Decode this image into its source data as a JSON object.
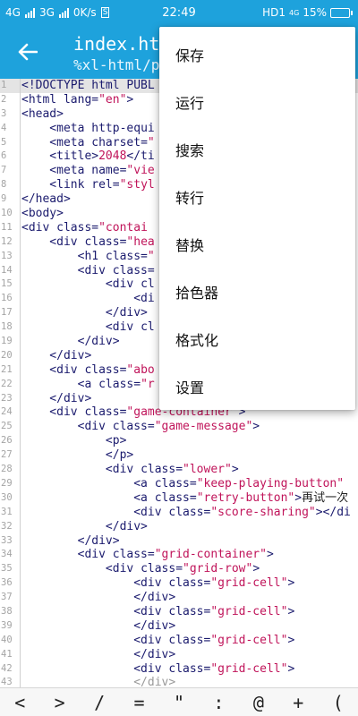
{
  "status_bar": {
    "network_1": "4G",
    "network_2": "3G",
    "speed": "0K/s",
    "s_badge": "S",
    "time": "22:49",
    "carrier": "HD1",
    "network_3": "4G",
    "battery": "15%",
    "battery_level": 0.15
  },
  "toolbar": {
    "title": "index.html",
    "path": "%xl-html/pr"
  },
  "editor": {
    "current_line": 1,
    "lines": [
      {
        "n": "1",
        "tokens": [
          {
            "t": "<!DOCTYPE html PUBL",
            "c": "c-tag"
          }
        ]
      },
      {
        "n": "2",
        "tokens": [
          {
            "t": "<html ",
            "c": "c-tag"
          },
          {
            "t": "lang=",
            "c": "c-attr"
          },
          {
            "t": "\"en\"",
            "c": "c-str"
          },
          {
            "t": ">",
            "c": "c-tag"
          }
        ]
      },
      {
        "n": "3",
        "tokens": [
          {
            "t": "<head>",
            "c": "c-tag"
          }
        ]
      },
      {
        "n": "4",
        "tokens": [
          {
            "t": "    <meta ",
            "c": "c-tag"
          },
          {
            "t": "http-equi",
            "c": "c-attr"
          }
        ]
      },
      {
        "n": "5",
        "tokens": [
          {
            "t": "    <meta ",
            "c": "c-tag"
          },
          {
            "t": "charset=",
            "c": "c-attr"
          },
          {
            "t": "\"",
            "c": "c-str"
          }
        ]
      },
      {
        "n": "6",
        "tokens": [
          {
            "t": "    <title>",
            "c": "c-tag"
          },
          {
            "t": "2048",
            "c": "c-str"
          },
          {
            "t": "</ti",
            "c": "c-tag"
          }
        ]
      },
      {
        "n": "7",
        "tokens": [
          {
            "t": "    <meta ",
            "c": "c-tag"
          },
          {
            "t": "name=",
            "c": "c-attr"
          },
          {
            "t": "\"vie",
            "c": "c-str"
          }
        ]
      },
      {
        "n": "8",
        "tokens": [
          {
            "t": "    <link ",
            "c": "c-tag"
          },
          {
            "t": "rel=",
            "c": "c-attr"
          },
          {
            "t": "\"styl",
            "c": "c-str"
          }
        ]
      },
      {
        "n": "9",
        "tokens": [
          {
            "t": "</head>",
            "c": "c-tag"
          }
        ]
      },
      {
        "n": "10",
        "tokens": [
          {
            "t": "<body>",
            "c": "c-tag"
          }
        ]
      },
      {
        "n": "11",
        "tokens": [
          {
            "t": "<div ",
            "c": "c-tag"
          },
          {
            "t": "class=",
            "c": "c-attr"
          },
          {
            "t": "\"contai",
            "c": "c-str"
          }
        ]
      },
      {
        "n": "12",
        "tokens": [
          {
            "t": "    <div ",
            "c": "c-tag"
          },
          {
            "t": "class=",
            "c": "c-attr"
          },
          {
            "t": "\"hea",
            "c": "c-str"
          }
        ]
      },
      {
        "n": "13",
        "tokens": [
          {
            "t": "        <h1 ",
            "c": "c-tag"
          },
          {
            "t": "class=",
            "c": "c-attr"
          },
          {
            "t": "\"",
            "c": "c-str"
          }
        ]
      },
      {
        "n": "14",
        "tokens": [
          {
            "t": "        <div ",
            "c": "c-tag"
          },
          {
            "t": "class=",
            "c": "c-attr"
          }
        ]
      },
      {
        "n": "15",
        "tokens": [
          {
            "t": "            <div ",
            "c": "c-tag"
          },
          {
            "t": "cl",
            "c": "c-attr"
          }
        ]
      },
      {
        "n": "16",
        "tokens": [
          {
            "t": "                <di",
            "c": "c-tag"
          }
        ]
      },
      {
        "n": "17",
        "tokens": [
          {
            "t": "            </div>",
            "c": "c-tag"
          }
        ]
      },
      {
        "n": "18",
        "tokens": [
          {
            "t": "            <div ",
            "c": "c-tag"
          },
          {
            "t": "cl",
            "c": "c-attr"
          }
        ]
      },
      {
        "n": "19",
        "tokens": [
          {
            "t": "        </div>",
            "c": "c-tag"
          }
        ]
      },
      {
        "n": "20",
        "tokens": [
          {
            "t": "    </div>",
            "c": "c-tag"
          }
        ]
      },
      {
        "n": "21",
        "tokens": [
          {
            "t": "    <div ",
            "c": "c-tag"
          },
          {
            "t": "class=",
            "c": "c-attr"
          },
          {
            "t": "\"abo",
            "c": "c-str"
          }
        ]
      },
      {
        "n": "22",
        "tokens": [
          {
            "t": "        <a ",
            "c": "c-tag"
          },
          {
            "t": "class=",
            "c": "c-attr"
          },
          {
            "t": "\"r",
            "c": "c-str"
          }
        ]
      },
      {
        "n": "23",
        "tokens": [
          {
            "t": "    </div>",
            "c": "c-tag"
          }
        ]
      },
      {
        "n": "24",
        "tokens": [
          {
            "t": "    <div ",
            "c": "c-tag"
          },
          {
            "t": "class=",
            "c": "c-attr"
          },
          {
            "t": "\"game-container\"",
            "c": "c-str"
          },
          {
            "t": ">",
            "c": "c-tag"
          }
        ]
      },
      {
        "n": "25",
        "tokens": [
          {
            "t": "        <div ",
            "c": "c-tag"
          },
          {
            "t": "class=",
            "c": "c-attr"
          },
          {
            "t": "\"game-message\"",
            "c": "c-str"
          },
          {
            "t": ">",
            "c": "c-tag"
          }
        ]
      },
      {
        "n": "26",
        "tokens": [
          {
            "t": "            <p>",
            "c": "c-tag"
          }
        ]
      },
      {
        "n": "27",
        "tokens": [
          {
            "t": "            </p>",
            "c": "c-tag"
          }
        ]
      },
      {
        "n": "28",
        "tokens": [
          {
            "t": "            <div ",
            "c": "c-tag"
          },
          {
            "t": "class=",
            "c": "c-attr"
          },
          {
            "t": "\"lower\"",
            "c": "c-str"
          },
          {
            "t": ">",
            "c": "c-tag"
          }
        ]
      },
      {
        "n": "29",
        "tokens": [
          {
            "t": "                <a ",
            "c": "c-tag"
          },
          {
            "t": "class=",
            "c": "c-attr"
          },
          {
            "t": "\"keep-playing-button\"",
            "c": "c-str"
          }
        ]
      },
      {
        "n": "30",
        "tokens": [
          {
            "t": "                <a ",
            "c": "c-tag"
          },
          {
            "t": "class=",
            "c": "c-attr"
          },
          {
            "t": "\"retry-button\"",
            "c": "c-str"
          },
          {
            "t": ">",
            "c": "c-tag"
          },
          {
            "t": "再试一次",
            "c": "c-txt"
          }
        ]
      },
      {
        "n": "31",
        "tokens": [
          {
            "t": "                <div ",
            "c": "c-tag"
          },
          {
            "t": "class=",
            "c": "c-attr"
          },
          {
            "t": "\"score-sharing\"",
            "c": "c-str"
          },
          {
            "t": "></di",
            "c": "c-tag"
          }
        ]
      },
      {
        "n": "32",
        "tokens": [
          {
            "t": "            </div>",
            "c": "c-tag"
          }
        ]
      },
      {
        "n": "33",
        "tokens": [
          {
            "t": "        </div>",
            "c": "c-tag"
          }
        ]
      },
      {
        "n": "34",
        "tokens": [
          {
            "t": "        <div ",
            "c": "c-tag"
          },
          {
            "t": "class=",
            "c": "c-attr"
          },
          {
            "t": "\"grid-container\"",
            "c": "c-str"
          },
          {
            "t": ">",
            "c": "c-tag"
          }
        ]
      },
      {
        "n": "35",
        "tokens": [
          {
            "t": "            <div ",
            "c": "c-tag"
          },
          {
            "t": "class=",
            "c": "c-attr"
          },
          {
            "t": "\"grid-row\"",
            "c": "c-str"
          },
          {
            "t": ">",
            "c": "c-tag"
          }
        ]
      },
      {
        "n": "36",
        "tokens": [
          {
            "t": "                <div ",
            "c": "c-tag"
          },
          {
            "t": "class=",
            "c": "c-attr"
          },
          {
            "t": "\"grid-cell\"",
            "c": "c-str"
          },
          {
            "t": ">",
            "c": "c-tag"
          }
        ]
      },
      {
        "n": "37",
        "tokens": [
          {
            "t": "                </div>",
            "c": "c-tag"
          }
        ]
      },
      {
        "n": "38",
        "tokens": [
          {
            "t": "                <div ",
            "c": "c-tag"
          },
          {
            "t": "class=",
            "c": "c-attr"
          },
          {
            "t": "\"grid-cell\"",
            "c": "c-str"
          },
          {
            "t": ">",
            "c": "c-tag"
          }
        ]
      },
      {
        "n": "39",
        "tokens": [
          {
            "t": "                </div>",
            "c": "c-tag"
          }
        ]
      },
      {
        "n": "40",
        "tokens": [
          {
            "t": "                <div ",
            "c": "c-tag"
          },
          {
            "t": "class=",
            "c": "c-attr"
          },
          {
            "t": "\"grid-cell\"",
            "c": "c-str"
          },
          {
            "t": ">",
            "c": "c-tag"
          }
        ]
      },
      {
        "n": "41",
        "tokens": [
          {
            "t": "                </div>",
            "c": "c-tag"
          }
        ]
      },
      {
        "n": "42",
        "tokens": [
          {
            "t": "                <div ",
            "c": "c-tag"
          },
          {
            "t": "class=",
            "c": "c-attr"
          },
          {
            "t": "\"grid-cell\"",
            "c": "c-str"
          },
          {
            "t": ">",
            "c": "c-tag"
          }
        ]
      },
      {
        "n": "43",
        "tokens": [
          {
            "t": "                </div>",
            "c": "c-dim"
          }
        ]
      }
    ]
  },
  "symbol_bar": [
    "<",
    ">",
    "/",
    "=",
    "\"",
    ":",
    "@",
    "+",
    "("
  ],
  "menu": {
    "items": [
      "保存",
      "运行",
      "搜索",
      "转行",
      "替换",
      "拾色器",
      "格式化",
      "设置"
    ]
  },
  "colors": {
    "accent": "#1ea2dc",
    "tag": "#1b1b6e",
    "string": "#c0145a",
    "line_number": "#a4a4a4"
  },
  "icons": {
    "back": "arrow-left-icon"
  }
}
